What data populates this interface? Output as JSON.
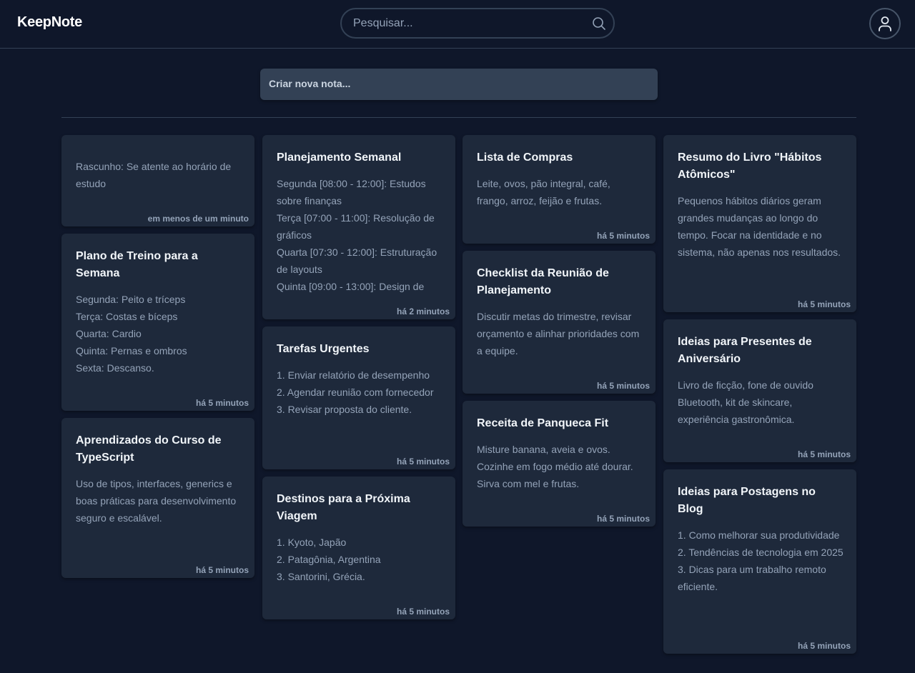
{
  "header": {
    "logo": "KeepNote",
    "search_placeholder": "Pesquisar..."
  },
  "new_note": {
    "placeholder": "Criar nova nota..."
  },
  "notes": [
    {
      "title": "",
      "body": "Rascunho: Se atente ao horário de estudo",
      "time": "em menos de um minuto"
    },
    {
      "title": "Plano de Treino para a Semana",
      "body": "Segunda: Peito e tríceps\nTerça: Costas e bíceps\nQuarta: Cardio\nQuinta: Pernas e ombros\nSexta: Descanso.",
      "time": "há 5 minutos"
    },
    {
      "title": "Aprendizados do Curso de TypeScript",
      "body": "Uso de tipos, interfaces, generics e boas práticas para desenvolvimento seguro e escalável.",
      "time": "há 5 minutos"
    },
    {
      "title": "Planejamento Semanal",
      "body": "Segunda [08:00 - 12:00]: Estudos sobre finanças\nTerça [07:00 - 11:00]: Resolução de gráficos\nQuarta [07:30 - 12:00]: Estruturação de layouts\nQuinta [09:00 - 13:00]: Design de",
      "time": "há 2 minutos"
    },
    {
      "title": "Tarefas Urgentes",
      "body": "1. Enviar relatório de desempenho\n2. Agendar reunião com fornecedor\n3. Revisar proposta do cliente.",
      "time": "há 5 minutos"
    },
    {
      "title": "Destinos para a Próxima Viagem",
      "body": "1. Kyoto, Japão\n2. Patagônia, Argentina\n3. Santorini, Grécia.",
      "time": "há 5 minutos"
    },
    {
      "title": "Lista de Compras",
      "body": "Leite, ovos, pão integral, café, frango, arroz, feijão e frutas.",
      "time": "há 5 minutos"
    },
    {
      "title": "Checklist da Reunião de Planejamento",
      "body": "Discutir metas do trimestre, revisar orçamento e alinhar prioridades com a equipe.",
      "time": "há 5 minutos"
    },
    {
      "title": "Receita de Panqueca Fit",
      "body": "Misture banana, aveia e ovos. Cozinhe em fogo médio até dourar. Sirva com mel e frutas.",
      "time": "há 5 minutos"
    },
    {
      "title": "Resumo do Livro \"Hábitos Atômicos\"",
      "body": "Pequenos hábitos diários geram grandes mudanças ao longo do tempo. Focar na identidade e no sistema, não apenas nos resultados.",
      "time": "há 5 minutos"
    },
    {
      "title": "Ideias para Presentes de Aniversário",
      "body": "Livro de ficção, fone de ouvido Bluetooth, kit de skincare, experiência gastronômica.",
      "time": "há 5 minutos"
    },
    {
      "title": "Ideias para Postagens no Blog",
      "body": "1. Como melhorar sua produtividade\n2. Tendências de tecnologia em 2025\n3. Dicas para um trabalho remoto eficiente.",
      "time": "há 5 minutos"
    }
  ]
}
